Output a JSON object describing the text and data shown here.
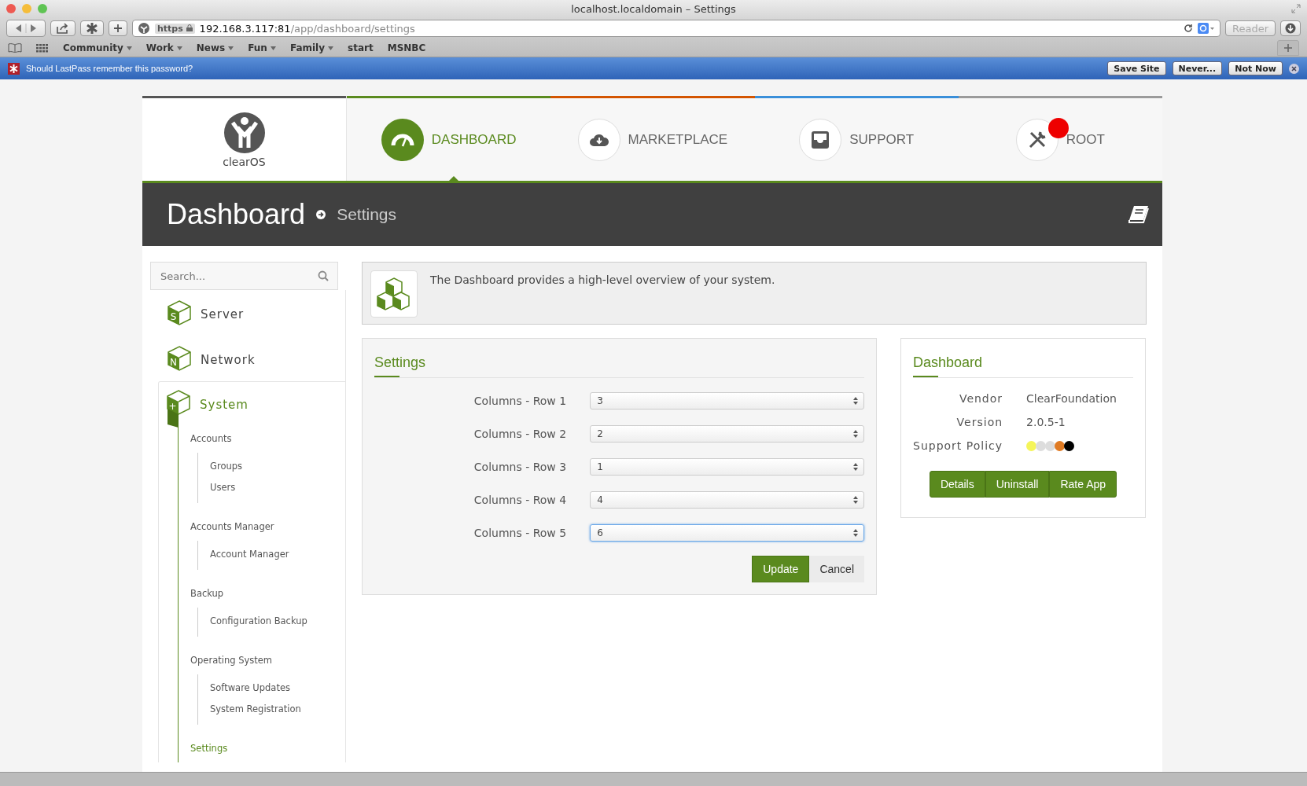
{
  "browser": {
    "title": "localhost.localdomain – Settings",
    "url_scheme": "https",
    "url_host": "192.168.3.117:81",
    "url_path": "/app/dashboard/settings",
    "reader": {
      "label": "Reader",
      "disabled": true
    },
    "bookmarks": [
      {
        "label": "Community",
        "menu": true
      },
      {
        "label": "Work",
        "menu": true
      },
      {
        "label": "News",
        "menu": true
      },
      {
        "label": "Fun",
        "menu": true
      },
      {
        "label": "Family",
        "menu": true
      },
      {
        "label": "start",
        "menu": false
      },
      {
        "label": "MSNBC",
        "menu": false
      }
    ]
  },
  "lastpass_bar": {
    "message": "Should LastPass remember this password?",
    "buttons": [
      "Save Site",
      "Never...",
      "Not Now"
    ]
  },
  "logo": {
    "text": "clearOS"
  },
  "nav_tabs": [
    {
      "label": "DASHBOARD",
      "color": "#5a8a1e",
      "selected": true,
      "badge": false
    },
    {
      "label": "MARKETPLACE",
      "color": "#d35400",
      "selected": false,
      "badge": false
    },
    {
      "label": "SUPPORT",
      "color": "#3a8fd9",
      "selected": false,
      "badge": false
    },
    {
      "label": "ROOT",
      "color": "#9a9a9a",
      "selected": false,
      "badge": true
    }
  ],
  "breadcrumb": {
    "title": "Dashboard",
    "sub": "Settings"
  },
  "sidebar": {
    "search": {
      "placeholder": "Search..."
    },
    "items": [
      {
        "label": "Server",
        "letter": "S",
        "expanded": false
      },
      {
        "label": "Network",
        "letter": "N",
        "expanded": false
      },
      {
        "label": "System",
        "letter": "+",
        "expanded": true,
        "children": [
          {
            "label": "Accounts",
            "selected": false,
            "children": [
              {
                "label": "Groups",
                "selected": false
              },
              {
                "label": "Users",
                "selected": false
              }
            ]
          },
          {
            "label": "Accounts Manager",
            "selected": false,
            "children": [
              {
                "label": "Account Manager",
                "selected": false
              }
            ]
          },
          {
            "label": "Backup",
            "selected": false,
            "children": [
              {
                "label": "Configuration Backup",
                "selected": false
              }
            ]
          },
          {
            "label": "Operating System",
            "selected": false,
            "children": [
              {
                "label": "Software Updates",
                "selected": false
              },
              {
                "label": "System Registration",
                "selected": false
              }
            ]
          },
          {
            "label": "Settings",
            "selected": true
          }
        ]
      }
    ]
  },
  "info": {
    "text": "The Dashboard provides a high-level overview of your system."
  },
  "settings_form": {
    "title": "Settings",
    "rows": [
      {
        "label": "Columns - Row 1",
        "value": "3",
        "focused": false
      },
      {
        "label": "Columns - Row 2",
        "value": "2",
        "focused": false
      },
      {
        "label": "Columns - Row 3",
        "value": "1",
        "focused": false
      },
      {
        "label": "Columns - Row 4",
        "value": "4",
        "focused": false
      },
      {
        "label": "Columns - Row 5",
        "value": "6",
        "focused": true
      }
    ],
    "buttons": [
      {
        "label": "Update",
        "kind": "primary"
      },
      {
        "label": "Cancel",
        "kind": "plain"
      }
    ]
  },
  "app_info": {
    "title": "Dashboard",
    "fields": [
      {
        "label": "Vendor",
        "value": "ClearFoundation"
      },
      {
        "label": "Version",
        "value": "2.0.5-1"
      }
    ],
    "support_policy": {
      "label": "Support Policy",
      "dots": [
        {
          "color": "#f5f55a"
        },
        {
          "color": "#dddddd"
        },
        {
          "color": "#dddddd"
        },
        {
          "color": "#e07b24"
        },
        {
          "color": "#000000"
        }
      ]
    },
    "buttons": [
      "Details",
      "Uninstall",
      "Rate App"
    ]
  }
}
